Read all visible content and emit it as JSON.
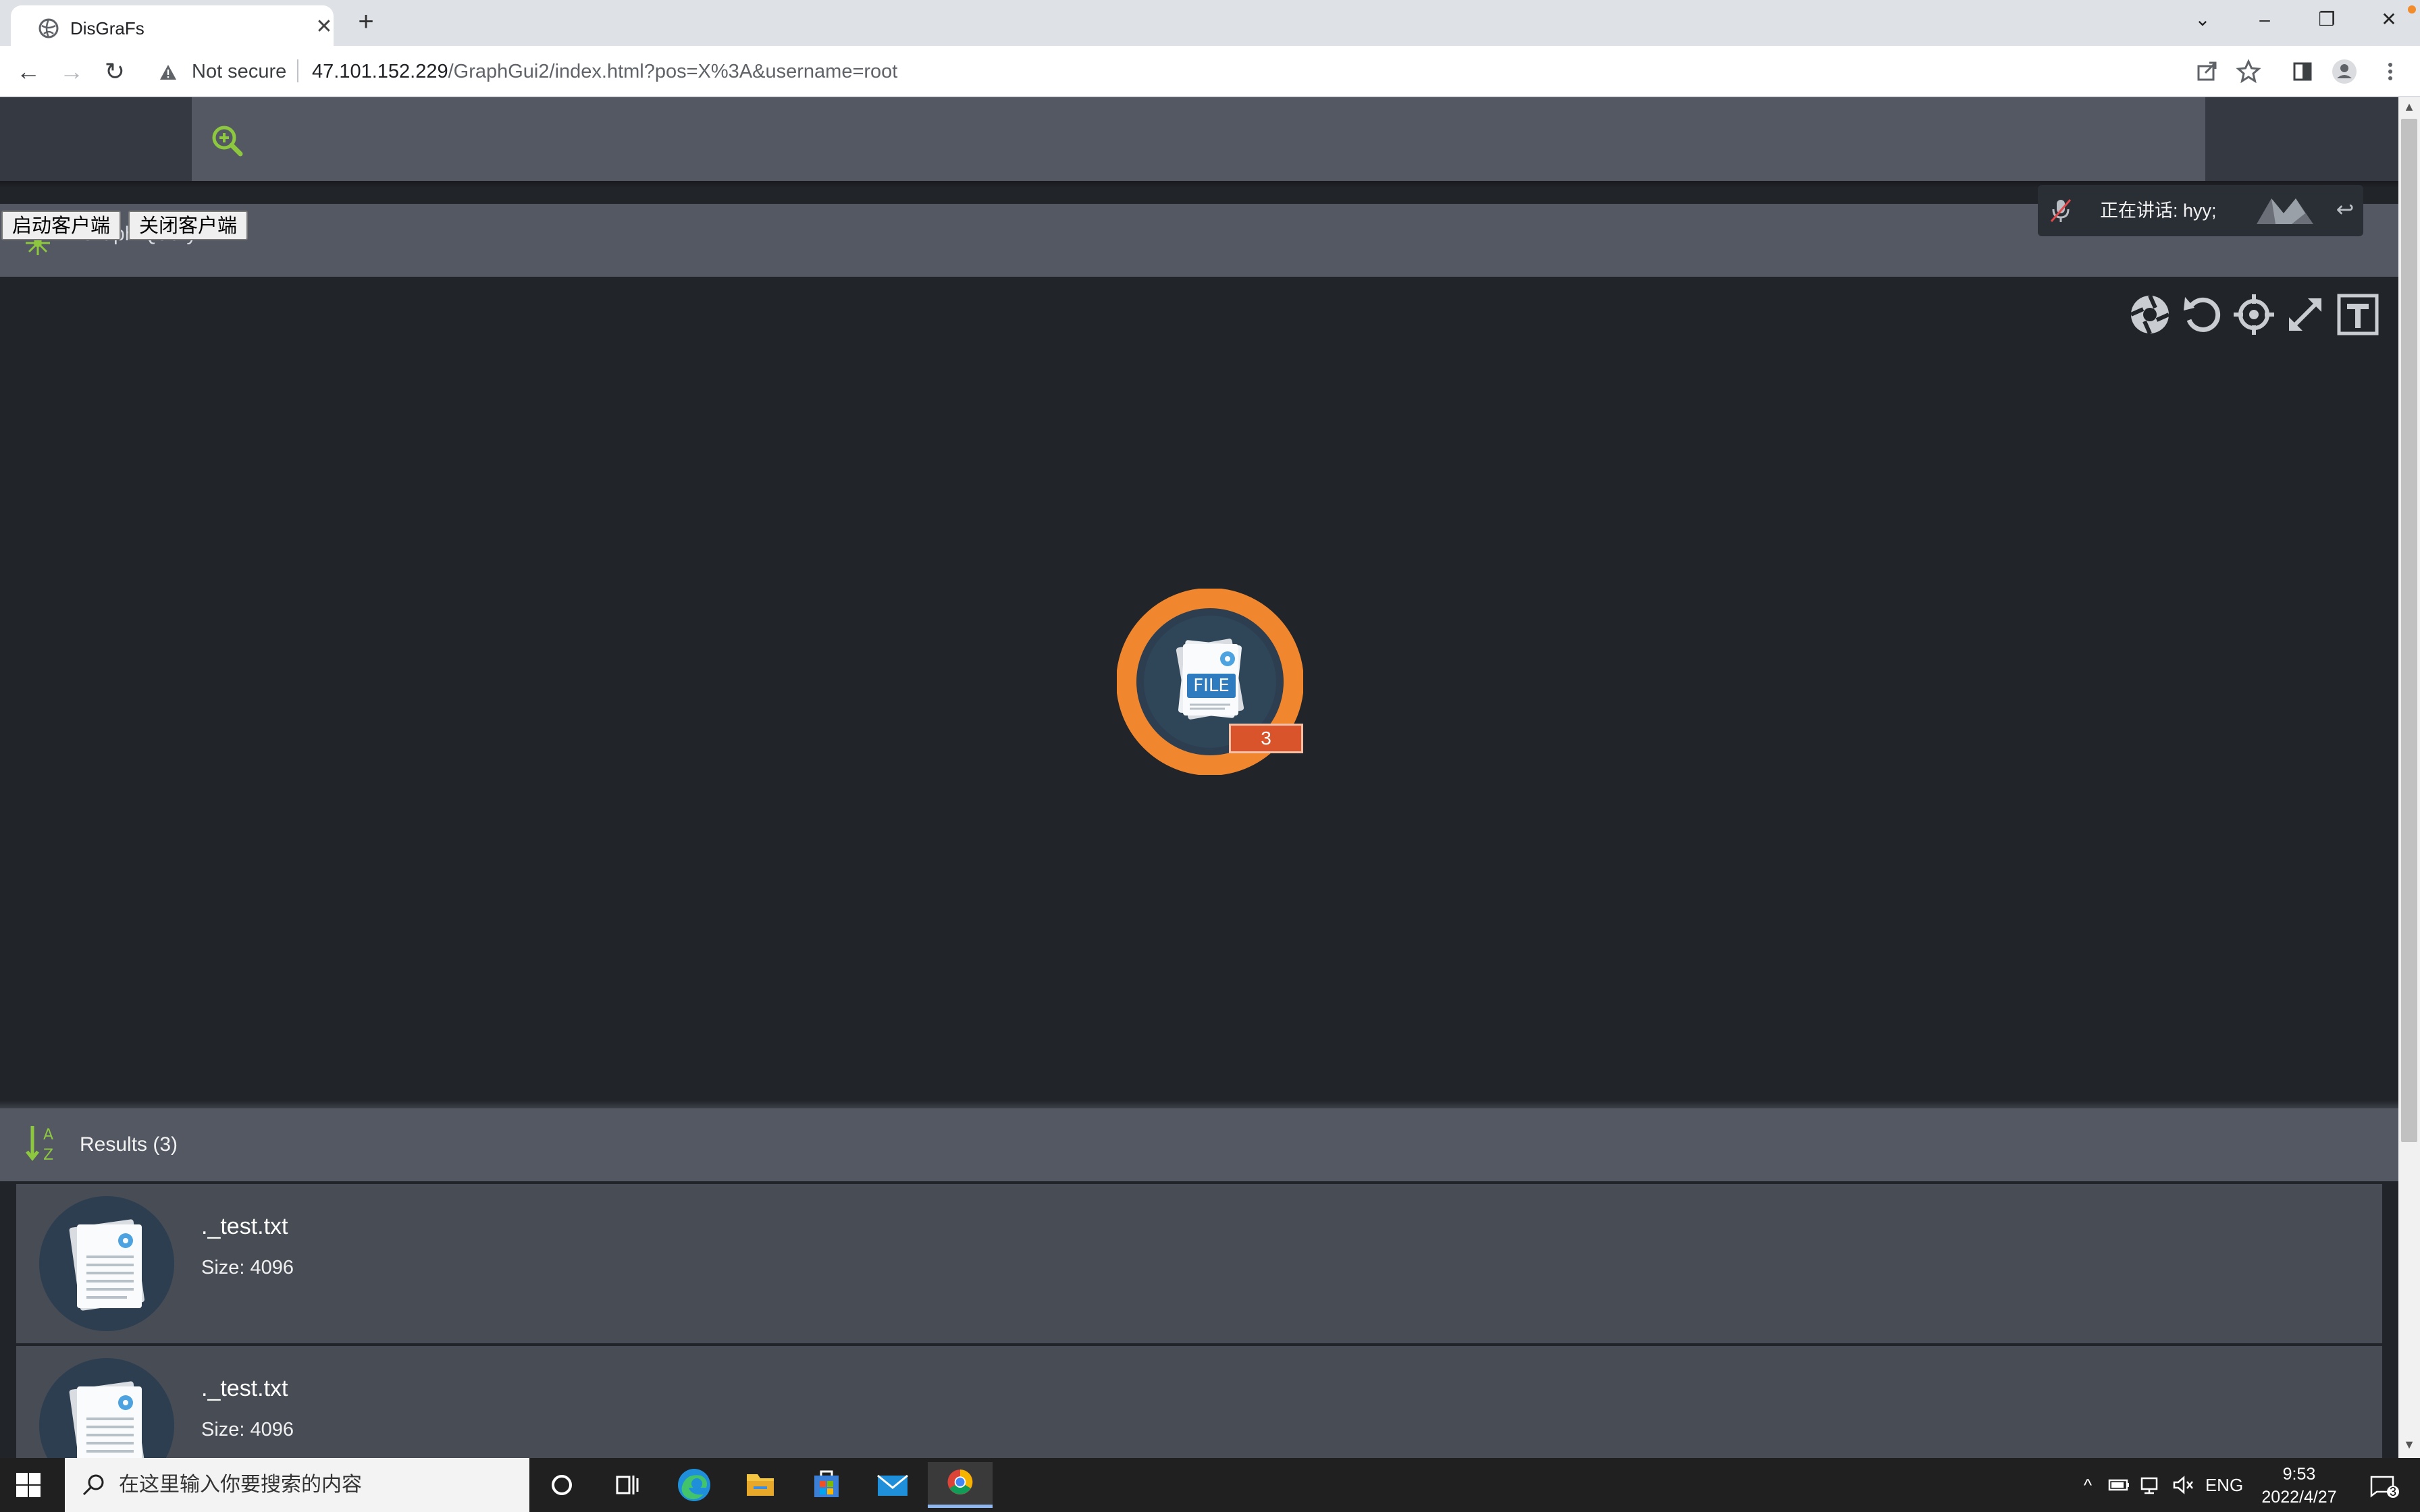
{
  "browser": {
    "tab_title": "DisGraFs",
    "tab_close": "✕",
    "new_tab": "+",
    "not_secure": "Not secure",
    "url_host": "47.101.152.229",
    "url_path": "/GraphGui2/index.html?pos=X%3A&username=root",
    "nav": {
      "back": "←",
      "forward": "→",
      "reload": "↻"
    },
    "window_controls": {
      "tab_search": "⌄",
      "minimize": "–",
      "restore": "❐",
      "close": "✕"
    }
  },
  "buttons": {
    "start_client": "启动客户端",
    "close_client": "关闭客户端"
  },
  "query_header": {
    "label": "Graph Query"
  },
  "voice": {
    "status": "正在讲话: hyy;"
  },
  "graph": {
    "node_badge": "3",
    "node_label": "FILE"
  },
  "results": {
    "label": "Results (3)",
    "items": [
      {
        "name": "._test.txt",
        "size": "Size: 4096"
      },
      {
        "name": "._test.txt",
        "size": "Size: 4096"
      }
    ]
  },
  "taskbar": {
    "search_placeholder": "在这里输入你要搜索的内容",
    "tray_lang": "ENG",
    "time": "9:53",
    "date": "2022/4/27",
    "notification_count": "3"
  },
  "colors": {
    "accent_green": "#8dc63f",
    "node_orange": "#f0862e",
    "badge_red": "#d9542a",
    "panel_bg": "#535862",
    "canvas_bg": "#212429"
  }
}
